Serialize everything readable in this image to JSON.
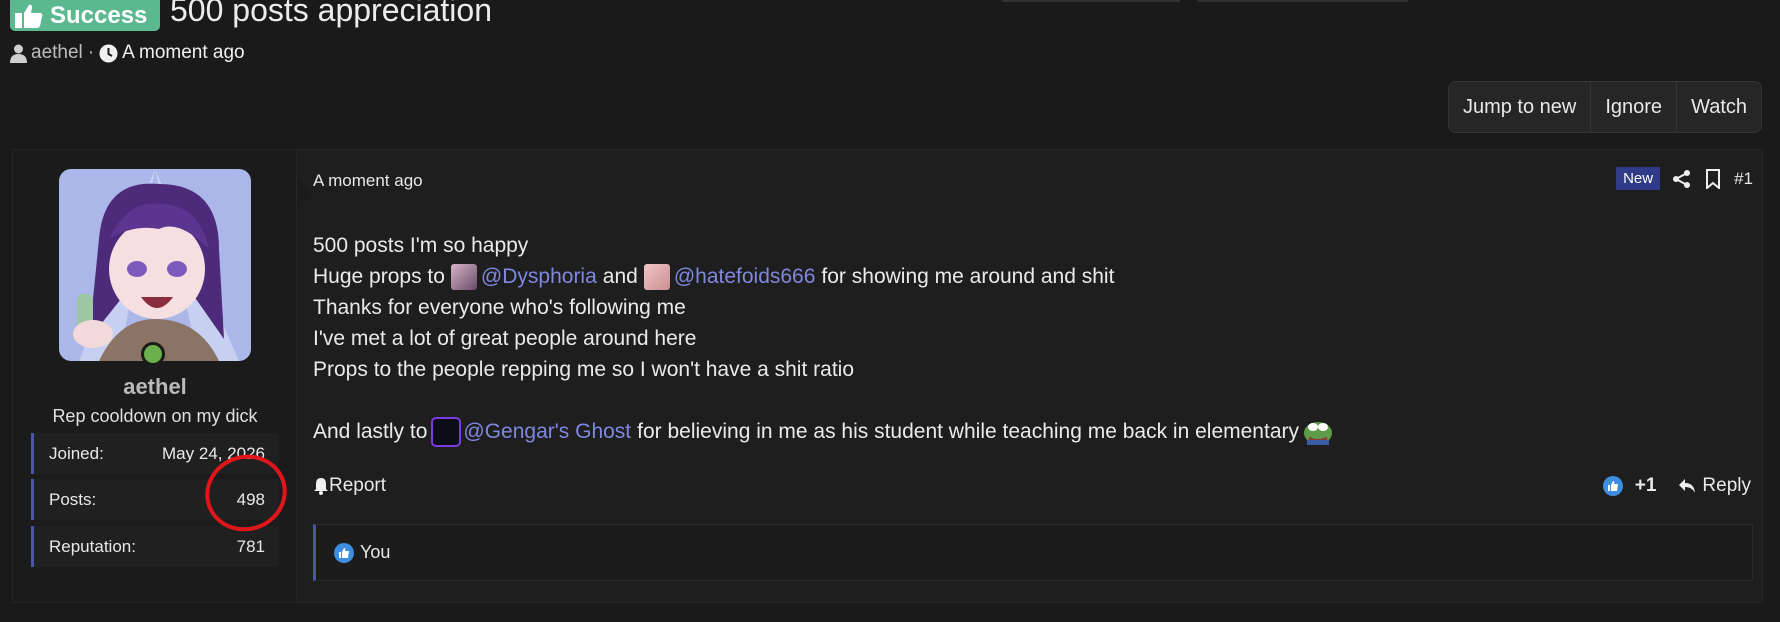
{
  "thread": {
    "prefix": "Success",
    "title": "500 posts appreciation",
    "author": "aethel",
    "time": "A moment ago"
  },
  "toolbar": {
    "jump_label": "Jump to new",
    "ignore_label": "Ignore",
    "watch_label": "Watch"
  },
  "user": {
    "name": "aethel",
    "title": "Rep cooldown on my dick",
    "stats": [
      {
        "label": "Joined:",
        "value": "May 24, 2026"
      },
      {
        "label": "Posts:",
        "value": "498"
      },
      {
        "label": "Reputation:",
        "value": "781"
      }
    ]
  },
  "post": {
    "time": "A moment ago",
    "new_badge": "New",
    "number": "#1",
    "line1": "500 posts I'm so happy",
    "line2_a": "Huge props to",
    "mention1": "@Dysphoria",
    "line2_b": "and",
    "mention2": "@hatefoids666",
    "line2_c": "for showing me around and shit",
    "line3": "Thanks for everyone who's following me",
    "line4": "I've met a lot of great people around here",
    "line5": "Props to the people repping me so I won't have a shit ratio",
    "line6_a": "And lastly to",
    "mention3": "@Gengar's Ghost",
    "line6_b": "for believing in me as his student while teaching me back in elementary",
    "report_label": "Report",
    "reaction_count": "+1",
    "reply_label": "Reply",
    "reacted_by": "You"
  },
  "colors": {
    "accent": "#4a56a8",
    "success": "#5cb88f",
    "mention": "#7f88e0",
    "online": "#6ab04c",
    "annotation": "#e0161b"
  }
}
